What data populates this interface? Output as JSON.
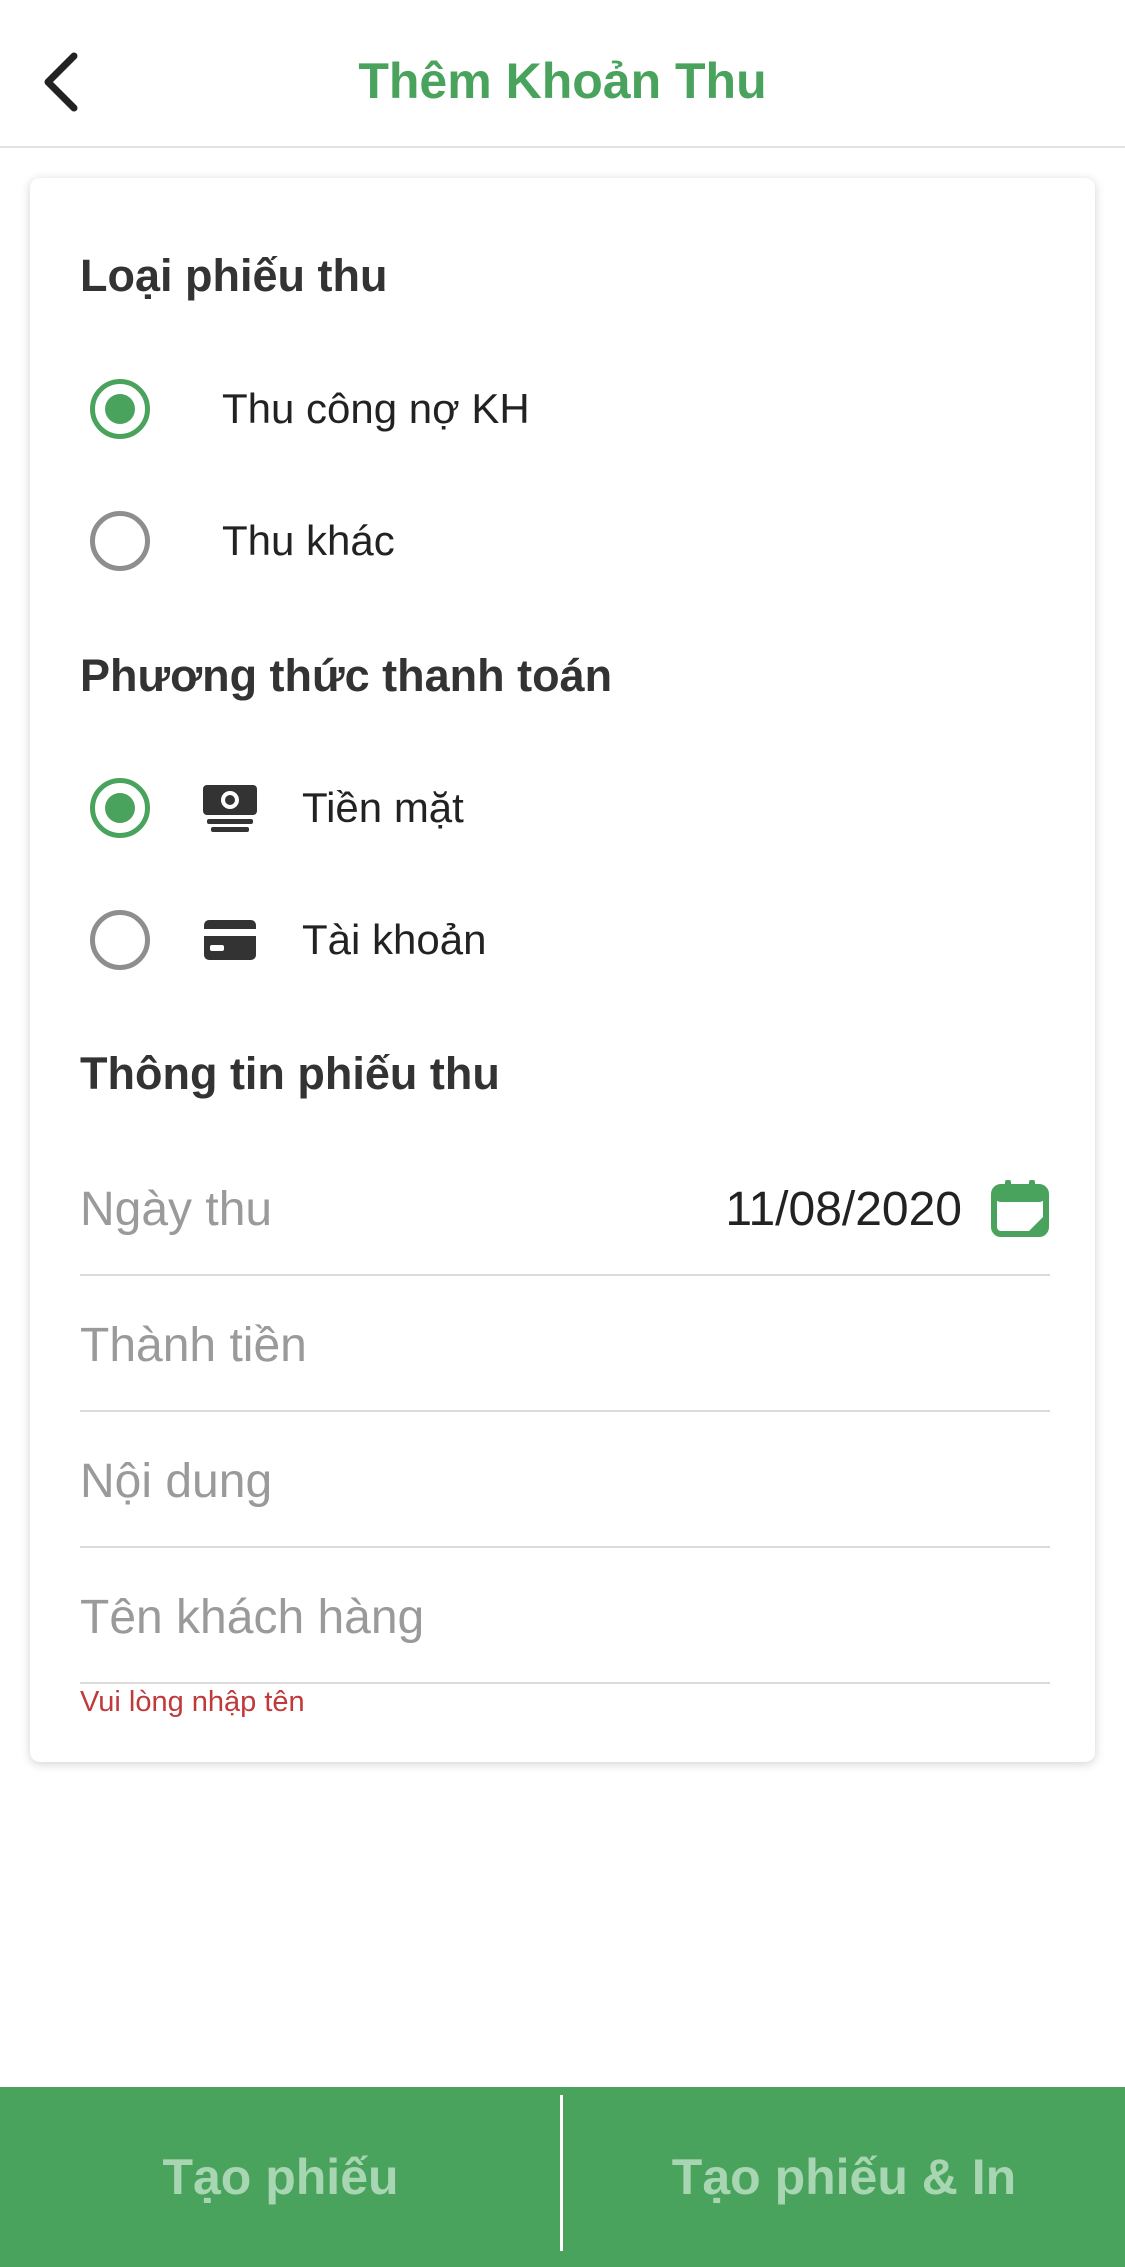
{
  "header": {
    "title": "Thêm Khoản Thu",
    "back_icon": "chevron-left-icon"
  },
  "receipt_type": {
    "title": "Loại phiếu thu",
    "options": [
      {
        "label": "Thu công nợ KH",
        "selected": true
      },
      {
        "label": "Thu khác",
        "selected": false
      }
    ]
  },
  "payment_method": {
    "title": "Phương thức thanh toán",
    "options": [
      {
        "label": "Tiền mặt",
        "icon": "cash-icon",
        "selected": true
      },
      {
        "label": "Tài khoản",
        "icon": "credit-card-icon",
        "selected": false
      }
    ]
  },
  "receipt_info": {
    "title": "Thông tin phiếu thu",
    "date": {
      "label": "Ngày thu",
      "value": "11/08/2020",
      "icon": "calendar-icon"
    },
    "amount": {
      "label": "Thành tiền"
    },
    "content": {
      "label": "Nội dung"
    },
    "customer": {
      "label": "Tên khách hàng",
      "error": "Vui lòng nhập tên"
    }
  },
  "actions": {
    "create": "Tạo phiếu",
    "create_print": "Tạo phiếu & In"
  },
  "colors": {
    "accent": "#4aa35d",
    "error": "#c0393b",
    "button_text": "#a8d6b2"
  }
}
